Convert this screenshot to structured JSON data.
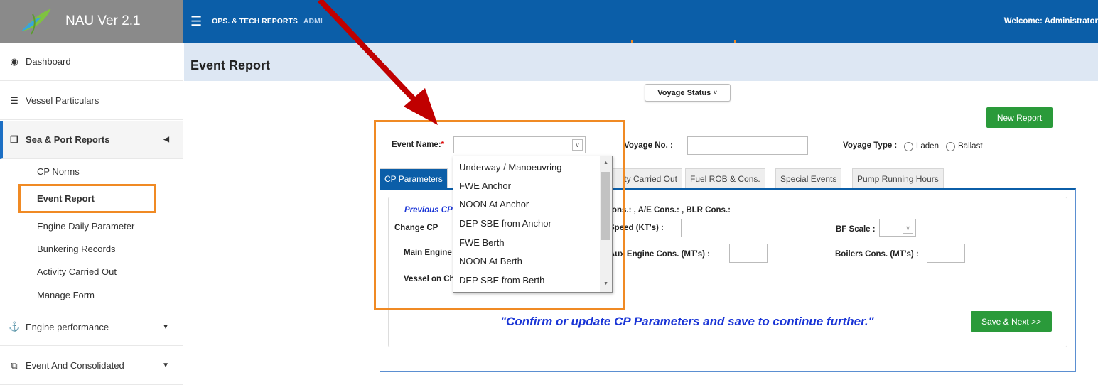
{
  "app": {
    "title": "NAU Ver 2.1"
  },
  "topnav": {
    "items": [
      "OPS. & TECH REPORTS",
      "ADMI"
    ],
    "welcome": "Welcome: Administrator"
  },
  "sidebar": {
    "items": [
      {
        "label": "Dashboard",
        "icon": "dashboard-icon"
      },
      {
        "label": "Vessel Particulars",
        "icon": "database-icon"
      },
      {
        "label": "Sea & Port Reports",
        "icon": "copy-icon",
        "active": true
      },
      {
        "label": "Engine performance",
        "icon": "anchor-icon"
      },
      {
        "label": "Event And Consolidated",
        "icon": "clone-icon"
      }
    ],
    "subitems": [
      "CP Norms",
      "Event Report",
      "Engine Daily Parameter",
      "Bunkering Records",
      "Activity Carried Out",
      "Manage Form"
    ],
    "selected_subitem": "Event Report"
  },
  "page": {
    "title": "Event Report"
  },
  "toolbar": {
    "voyage_status": "Voyage Status",
    "new_report": "New Report"
  },
  "form": {
    "event_name_label": "Event Name:",
    "required_mark": "*",
    "voyage_no_label": "Voyage No. :",
    "voyage_no_value": "",
    "voyage_type_label": "Voyage Type :",
    "voyage_type_options": [
      "Laden",
      "Ballast"
    ]
  },
  "tabs": [
    "CP Parameters",
    "ty Carried Out",
    "Fuel ROB & Cons.",
    "Special Events",
    "Pump Running Hours"
  ],
  "panel": {
    "previous_cp": "Previous CP",
    "cons_text": "ons.: , A/E Cons.: , BLR Cons.:",
    "change_cp": "Change CP",
    "speed_label": "Speed (KT's) :",
    "bf_scale_label": "BF Scale :",
    "main_engine": "Main Engine",
    "aux_engine_label": "Aux Engine Cons. (MT's) :",
    "boilers_label": "Boilers Cons. (MT's) :",
    "vessel_on": "Vessel on Ch",
    "confirm_message": "\"Confirm or update CP Parameters and save to continue further.\"",
    "save_next": "Save & Next >>"
  },
  "dropdown": {
    "options": [
      "Underway / Manoeuvring",
      "FWE Anchor",
      "NOON At Anchor",
      "DEP SBE from Anchor",
      "FWE Berth",
      "NOON At Berth",
      "DEP SBE from Berth"
    ]
  },
  "colors": {
    "accent": "#0b5ea8",
    "green": "#2a9a3a",
    "highlight": "#f08a24",
    "arrow": "#c00000",
    "message": "#1a35d6"
  }
}
